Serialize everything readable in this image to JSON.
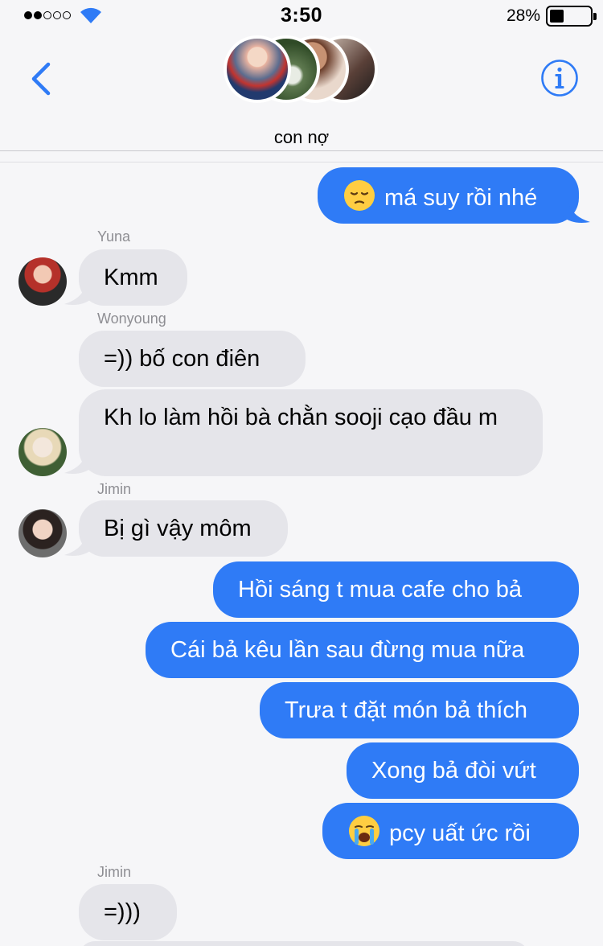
{
  "status": {
    "time": "3:50",
    "battery_percent": "28%",
    "battery_level": 0.28,
    "signal_bars_filled": 2,
    "signal_bars_total": 5
  },
  "header": {
    "back_icon": "chevron-left-icon",
    "info_icon": "info-icon",
    "title": "con nợ"
  },
  "messages": [
    {
      "direction": "out",
      "emoji": "pensive-face-emoji",
      "text": "má suy rồi nhé"
    },
    {
      "direction": "in",
      "sender": "Yuna",
      "text": "Kmm"
    },
    {
      "direction": "in",
      "sender": "Wonyoung",
      "text": "=)) bố con điên"
    },
    {
      "direction": "in",
      "sender": "",
      "text": "Kh lo làm hồi bà chằn sooji cạo đầu m"
    },
    {
      "direction": "in",
      "sender": "Jimin",
      "text": "Bị gì vậy môm"
    },
    {
      "direction": "out",
      "text": "Hồi sáng t mua cafe cho bả"
    },
    {
      "direction": "out",
      "text": "Cái bả kêu lần sau đừng mua nữa"
    },
    {
      "direction": "out",
      "text": "Trưa t đặt món bả thích"
    },
    {
      "direction": "out",
      "text": "Xong bả đòi vứt"
    },
    {
      "direction": "out",
      "emoji": "crying-face-emoji",
      "text": "pcy uất ức rồi"
    },
    {
      "direction": "in",
      "sender": "Jimin",
      "text": "=)))"
    }
  ],
  "colors": {
    "outgoing_bubble": "#2f7bf6",
    "incoming_bubble": "#e5e5ea",
    "accent": "#2f7bf6",
    "sender_label": "#8e8e93"
  }
}
